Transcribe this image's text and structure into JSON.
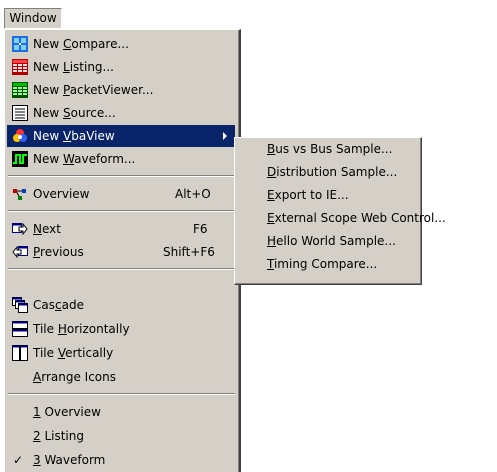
{
  "menubar": {
    "window_label": "Window"
  },
  "menu": {
    "items": [
      {
        "label": "New Compare...",
        "accel_pre": "New ",
        "accel": "C",
        "accel_post": "ompare...",
        "icon": "compare-icon"
      },
      {
        "label": "New Listing...",
        "accel_pre": "New ",
        "accel": "L",
        "accel_post": "isting...",
        "icon": "listing-icon"
      },
      {
        "label": "New PacketViewer...",
        "accel_pre": "New ",
        "accel": "P",
        "accel_post": "acketViewer...",
        "icon": "packetviewer-icon"
      },
      {
        "label": "New Source...",
        "accel_pre": "New ",
        "accel": "S",
        "accel_post": "ource...",
        "icon": "source-icon"
      },
      {
        "label": "New VbaView",
        "accel_pre": "New ",
        "accel": "V",
        "accel_post": "baView",
        "icon": "vbaview-icon",
        "highlighted": true
      },
      {
        "label": "New Waveform...",
        "accel_pre": "New ",
        "accel": "W",
        "accel_post": "aveform...",
        "icon": "waveform-icon"
      },
      {
        "label": "Overview",
        "shortcut": "Alt+O",
        "icon": "overview-icon"
      },
      {
        "label": "Next",
        "accel": "N",
        "accel_post": "ext",
        "shortcut": "F6",
        "icon": "next-icon"
      },
      {
        "label": "Previous",
        "accel": "P",
        "accel_post": "revious",
        "shortcut": "Shift+F6",
        "icon": "previous-icon"
      },
      {
        "label": "Cascade",
        "accel_pre": "Cas",
        "accel": "c",
        "accel_post": "ade",
        "icon": "cascade-icon"
      },
      {
        "label": "Tile Horizontally",
        "accel_pre": "Tile ",
        "accel": "H",
        "accel_post": "orizontally",
        "icon": "tile-horizontal-icon"
      },
      {
        "label": "Tile Vertically",
        "accel_pre": "Tile ",
        "accel": "V",
        "accel_post": "ertically",
        "icon": "tile-vertical-icon"
      },
      {
        "label": "Arrange Icons",
        "accel": "A",
        "accel_post": "rrange Icons"
      },
      {
        "label": "1 Overview",
        "accel": "1",
        "accel_post": " Overview"
      },
      {
        "label": "2 Listing",
        "accel": "2",
        "accel_post": " Listing"
      },
      {
        "label": "3 Waveform",
        "accel": "3",
        "accel_post": " Waveform",
        "checked": true,
        "check_mark": "✓"
      }
    ]
  },
  "submenu": {
    "items": [
      {
        "label": "Bus vs Bus Sample...",
        "accel": "B",
        "accel_post": "us vs Bus Sample..."
      },
      {
        "label": "Distribution Sample...",
        "accel": "D",
        "accel_post": "istribution Sample..."
      },
      {
        "label": "Export to IE...",
        "accel": "E",
        "accel_post": "xport to IE..."
      },
      {
        "label": "External Scope Web Control...",
        "accel": "E",
        "accel_post": "xternal Scope Web Control..."
      },
      {
        "label": "Hello World Sample...",
        "accel": "H",
        "accel_post": "ello World Sample..."
      },
      {
        "label": "Timing Compare...",
        "accel": "T",
        "accel_post": "iming Compare..."
      }
    ]
  },
  "colors": {
    "menu_bg": "#d4d0c8",
    "highlight": "#0a246a",
    "highlight_text": "#ffffff"
  }
}
